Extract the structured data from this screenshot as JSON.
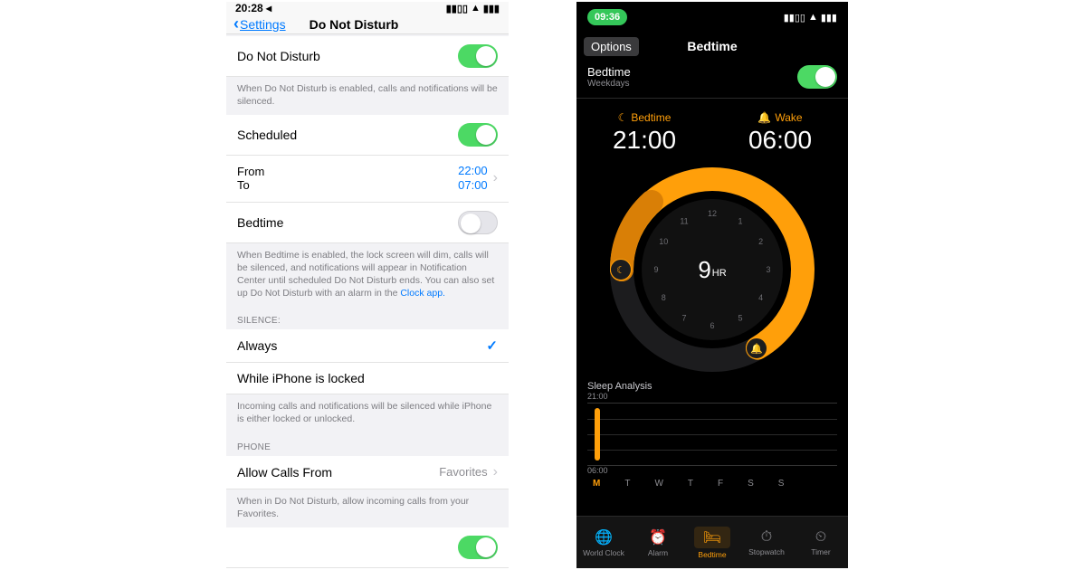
{
  "left": {
    "status": {
      "time": "20:28 ◂"
    },
    "nav": {
      "back": "Settings",
      "title": "Do Not Disturb"
    },
    "dnd": {
      "label": "Do Not Disturb",
      "on": true,
      "foot": "When Do Not Disturb is enabled, calls and notifications will be silenced."
    },
    "sched": {
      "label": "Scheduled",
      "on": true
    },
    "from": {
      "label": "From",
      "val": "22:00"
    },
    "to": {
      "label": "To",
      "val": "07:00"
    },
    "bed": {
      "label": "Bedtime",
      "on": false,
      "foot": "When Bedtime is enabled, the lock screen will dim, calls will be silenced, and notifications will appear in Notification Center until scheduled Do Not Disturb ends. You can also set up Do Not Disturb with an alarm in the ",
      "link": "Clock app."
    },
    "silence": {
      "header": "SILENCE:",
      "always": "Always",
      "locked": "While iPhone is locked",
      "foot": "Incoming calls and notifications will be silenced while iPhone is either locked or unlocked."
    },
    "phone": {
      "header": "PHONE",
      "allow": "Allow Calls From",
      "val": "Favorites",
      "foot": "When in Do Not Disturb, allow incoming calls from your Favorites."
    }
  },
  "right": {
    "status": {
      "time": "09:36"
    },
    "nav": {
      "options": "Options",
      "title": "Bedtime"
    },
    "row": {
      "title": "Bedtime",
      "sub": "Weekdays",
      "on": true
    },
    "bed": {
      "label": "Bedtime",
      "val": "21:00"
    },
    "wake": {
      "label": "Wake",
      "val": "06:00"
    },
    "dial": {
      "hours": "9",
      "unit": "HR",
      "ticks": [
        "12",
        "1",
        "2",
        "3",
        "4",
        "5",
        "6",
        "7",
        "8",
        "9",
        "10",
        "11"
      ]
    },
    "analysis": {
      "title": "Sleep Analysis",
      "top": "21:00",
      "bot": "06:00",
      "days": [
        "M",
        "T",
        "W",
        "T",
        "F",
        "S",
        "S"
      ]
    },
    "tabs": {
      "world": "World Clock",
      "alarm": "Alarm",
      "bed": "Bedtime",
      "stop": "Stopwatch",
      "timer": "Timer"
    }
  },
  "chart_data": {
    "type": "bar",
    "title": "Sleep Analysis",
    "categories": [
      "M",
      "T",
      "W",
      "T",
      "F",
      "S",
      "S"
    ],
    "series": [
      {
        "name": "sleep",
        "values": [
          9,
          null,
          null,
          null,
          null,
          null,
          null
        ]
      }
    ],
    "ylabel": "",
    "ylim_labels": [
      "21:00",
      "06:00"
    ]
  }
}
